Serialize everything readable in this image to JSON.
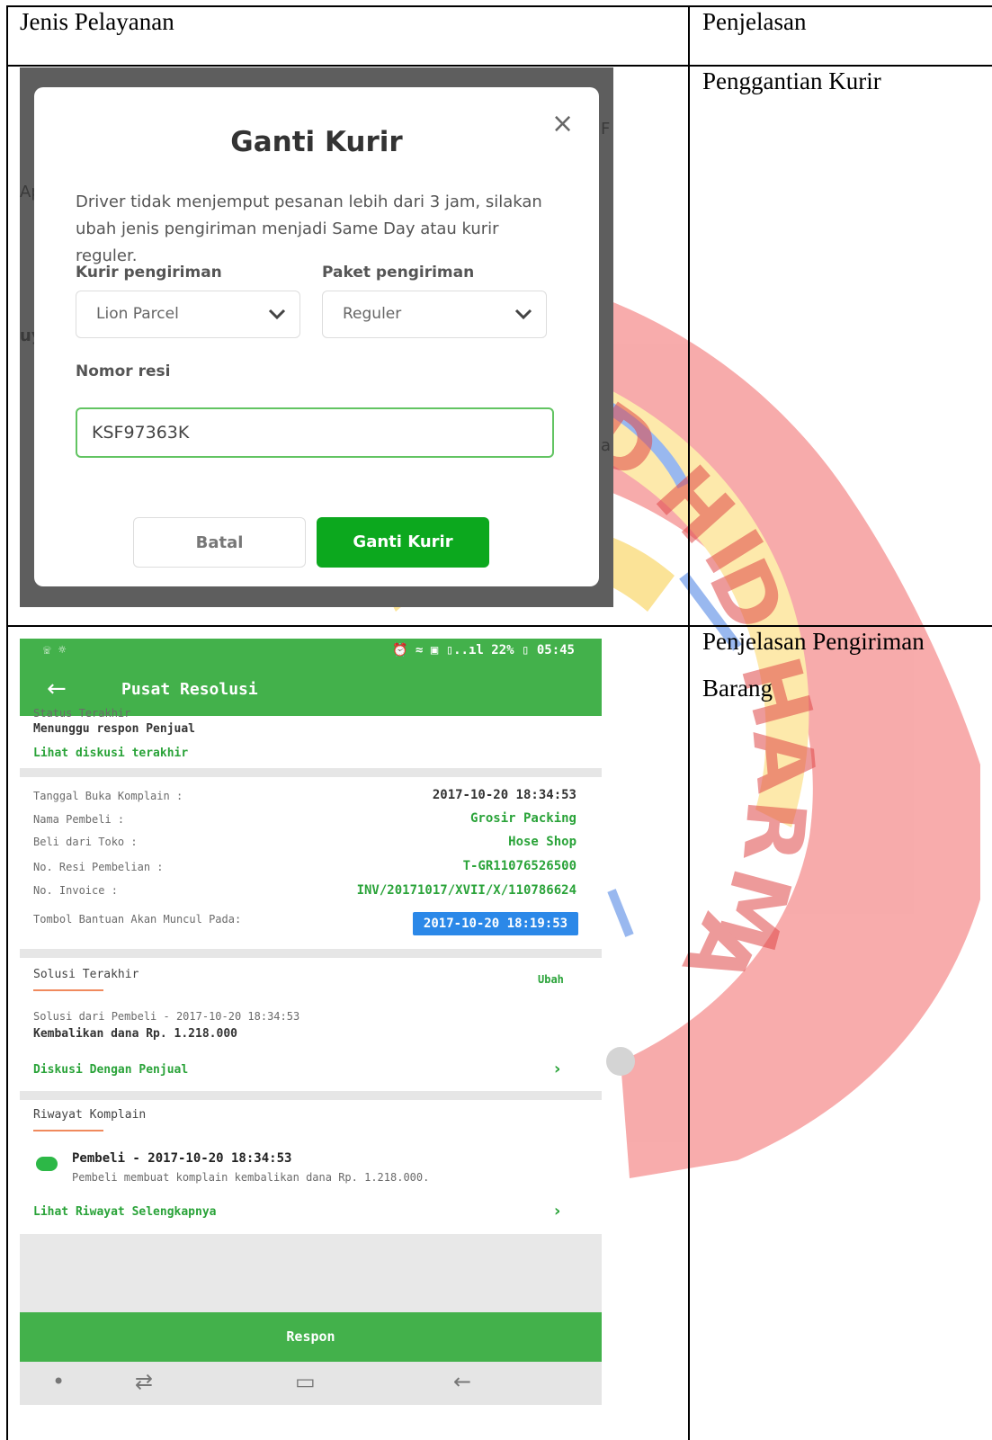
{
  "table": {
    "header": {
      "col1": "Jenis Pelayanan",
      "col2": "Penjelasan"
    },
    "rows": [
      {
        "explanation": "Penggantian Kurir"
      },
      {
        "explanation_line1": "Penjelasan Pengiriman",
        "explanation_line2": "Barang"
      }
    ]
  },
  "watermark": {
    "text": "DHI DHARMA",
    "colors": {
      "red": "#f2585c",
      "yellow": "#fde585",
      "blue": "#5c8be0"
    }
  },
  "dialog": {
    "background_fragments": [
      "Ap",
      "uy",
      "F",
      "a"
    ],
    "title": "Ganti Kurir",
    "close": "×",
    "description": "Driver tidak menjemput pesanan lebih dari 3 jam, silakan ubah jenis pengiriman menjadi Same Day atau kurir reguler.",
    "kurir_label": "Kurir pengiriman",
    "kurir_value": "Lion Parcel",
    "paket_label": "Paket pengiriman",
    "paket_value": "Reguler",
    "resi_label": "Nomor resi",
    "resi_value": "KSF97363K",
    "cancel_button": "Batal",
    "confirm_button": "Ganti Kurir",
    "accent": "#0ca81e"
  },
  "phone": {
    "status_left": "☏ ☼",
    "status_right": "⏰ ≈ ▣ ▯..ıl 22% ▯ 05:45",
    "appbar_title": "Pusat Resolusi",
    "status_label": "Status Terakhir",
    "status_value": "Menunggu respon Penjual",
    "last_discussion_link": "Lihat diskusi terakhir",
    "details": [
      {
        "label": "Tanggal Buka Komplain :",
        "value": "2017-10-20 18:34:53"
      },
      {
        "label": "Nama Pembeli :",
        "value": "Grosir Packing"
      },
      {
        "label": "Beli dari Toko :",
        "value": "Hose Shop"
      },
      {
        "label": "No. Resi Pembelian :",
        "value": "T-GR11076526500"
      },
      {
        "label": "No. Invoice :",
        "value": "INV/20171017/XVII/X/110786624"
      },
      {
        "label": "Tombol Bantuan Akan Muncul Pada:",
        "value": "2017-10-20 18:19:53"
      }
    ],
    "solution_title": "Solusi Terakhir",
    "solution_edit": "Ubah",
    "solution_meta": "Solusi dari Pembeli - 2017-10-20 18:34:53",
    "solution_value": "Kembalikan dana Rp. 1.218.000",
    "discussion_link": "Diskusi Dengan Penjual",
    "history_title": "Riwayat Komplain",
    "history_entry_title": "Pembeli - 2017-10-20 18:34:53",
    "history_entry_desc": "Pembeli membuat komplain kembalikan dana Rp. 1.218.000.",
    "history_link": "Lihat Riwayat Selengkapnya",
    "respond_button": "Respon",
    "nav_dot": "•",
    "nav_recent": "⇄",
    "nav_home": "▭",
    "nav_back": "←",
    "accent": "#43b14b"
  }
}
